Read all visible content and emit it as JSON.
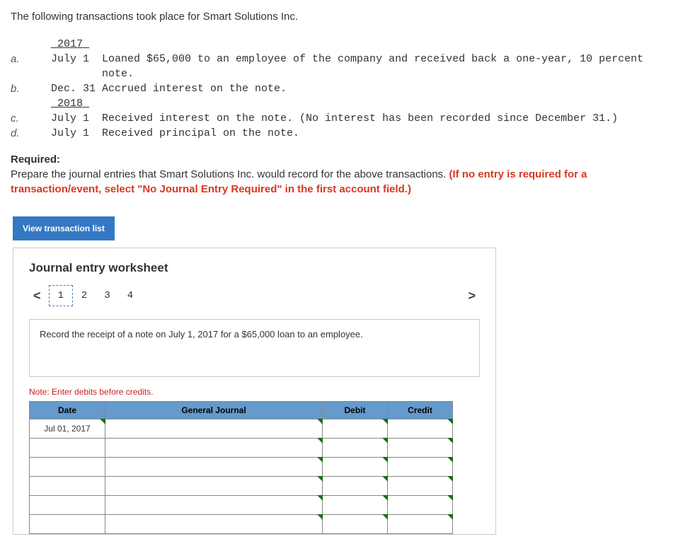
{
  "intro": "The following transactions took place for Smart Solutions Inc.",
  "txns": {
    "year1": "2017",
    "a": {
      "label": "a.",
      "date": "July  1",
      "desc": "Loaned $65,000 to an employee of the company and received back a one-year, 10 percent note."
    },
    "b": {
      "label": "b.",
      "date": "Dec. 31",
      "desc": "Accrued interest on the note."
    },
    "year2": "2018",
    "c": {
      "label": "c.",
      "date": "July  1",
      "desc": "Received interest on the note. (No interest has been recorded since December 31.)"
    },
    "d": {
      "label": "d.",
      "date": "July  1",
      "desc": "Received principal on the note."
    }
  },
  "required_label": "Required:",
  "required_text": "Prepare the journal entries that Smart Solutions Inc. would record for the above transactions. ",
  "required_red": "(If no entry is required for a transaction/event, select \"No Journal Entry Required\" in the first account field.)",
  "view_btn": "View transaction list",
  "ws_title": "Journal entry worksheet",
  "tabs": {
    "t1": "1",
    "t2": "2",
    "t3": "3",
    "t4": "4"
  },
  "chev_left": "<",
  "chev_right": ">",
  "instruction": "Record the receipt of a note on July 1, 2017 for a $65,000 loan to an employee.",
  "note": "Note: Enter debits before credits.",
  "headers": {
    "date": "Date",
    "gj": "General Journal",
    "debit": "Debit",
    "credit": "Credit"
  },
  "rows": {
    "r1": {
      "date": "Jul 01, 2017"
    }
  }
}
